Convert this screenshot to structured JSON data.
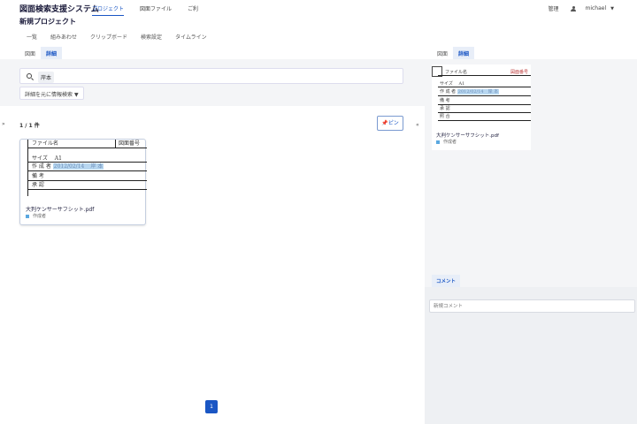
{
  "header": {
    "app_title": "図面検索支援システム",
    "nav": [
      {
        "label": "プロジェクト",
        "active": true
      },
      {
        "label": "図面ファイル",
        "active": false
      },
      {
        "label": "ご利",
        "active": false
      }
    ],
    "settings_label": "管理",
    "username": "michael"
  },
  "project": {
    "title": "新規プロジェクト",
    "subnav": [
      "一覧",
      "組みあわせ",
      "クリップボード",
      "検索設定",
      "タイムライン"
    ]
  },
  "left_tabs": [
    {
      "label": "図面",
      "active": false
    },
    {
      "label": "詳細",
      "active": true
    }
  ],
  "search": {
    "chip": "岸本",
    "filter_button": "詳細を元に情報検索"
  },
  "results": {
    "count": "1 / 1 件",
    "pin_label": "ピン",
    "expand_icon": "»",
    "collapse_icon": "«",
    "card": {
      "title_block": {
        "file_label": "ファイル名",
        "number_label": "図面番号",
        "size_label": "サイズ",
        "size_value": "A1",
        "author_label": "作 成 者",
        "date_value": "2012/02/14",
        "author_value": "岸 本",
        "note1": "備 考",
        "note2": "承 認"
      },
      "file_name": "大判ケンサーサフシット.pdf",
      "status": "作成者"
    }
  },
  "pagination": {
    "current": "1"
  },
  "right": {
    "tabs": [
      {
        "label": "図面",
        "active": false
      },
      {
        "label": "詳細",
        "active": true
      }
    ],
    "detail": {
      "file_label": "ファイル名",
      "number_label": "図面番号",
      "size_label": "サイズ",
      "size_value": "A1",
      "author_label": "作 成 者",
      "date_value": "2012/02/14",
      "author_value": "岸 本",
      "row3": "備 考",
      "row4": "承 認",
      "row5": "照 合",
      "file_name": "大判ケンサーサフシット.pdf",
      "status": "作成者"
    },
    "comment_tab": "コメント",
    "comment_placeholder": "新規コメント"
  },
  "colors": {
    "accent": "#1a56c4",
    "highlight": "#b8d7f0",
    "panel_bg": "#f4f5f7",
    "status_dot": "#5aa8e0"
  }
}
